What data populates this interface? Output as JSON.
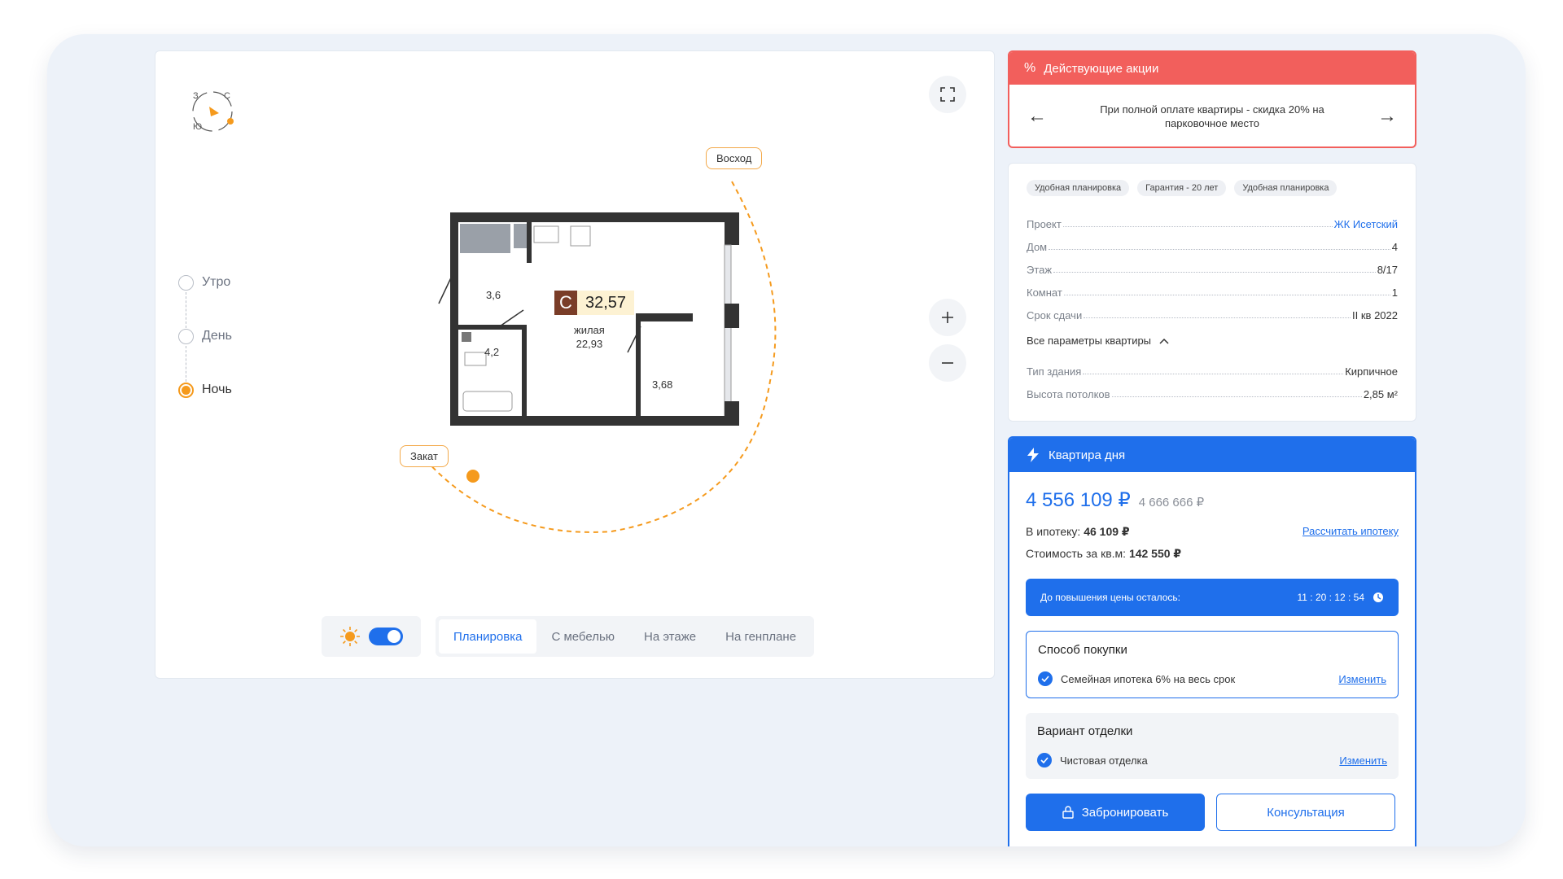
{
  "compass": {
    "w": "З",
    "n": "С",
    "s": "Ю"
  },
  "time_of_day": [
    {
      "label": "Утро",
      "selected": false
    },
    {
      "label": "День",
      "selected": false
    },
    {
      "label": "Ночь",
      "selected": true
    }
  ],
  "plan": {
    "sunrise": "Восход",
    "sunset": "Закат",
    "room_hall": "3,6",
    "room_bath": "4,2",
    "room_balcony": "3,68",
    "badge_letter": "С",
    "total_area": "32,57",
    "living_label": "жилая",
    "living_area": "22,93"
  },
  "view_tabs": [
    {
      "label": "Планировка",
      "active": true
    },
    {
      "label": "С мебелью",
      "active": false
    },
    {
      "label": "На этаже",
      "active": false
    },
    {
      "label": "На генплане",
      "active": false
    }
  ],
  "promo": {
    "title": "Действующие акции",
    "text": "При полной оплате квартиры - скидка 20% на парковочное место"
  },
  "params": {
    "chips": [
      "Удобная планировка",
      "Гарантия - 20 лет",
      "Удобная планировка"
    ],
    "rows": [
      {
        "label": "Проект",
        "value": "ЖК Исетский"
      },
      {
        "label": "Дом",
        "value": "4"
      },
      {
        "label": "Этаж",
        "value": "8/17"
      },
      {
        "label": "Комнат",
        "value": "1"
      },
      {
        "label": "Срок сдачи",
        "value": "II кв 2022"
      }
    ],
    "all_label": "Все параметры квартиры",
    "extra_rows": [
      {
        "label": "Тип здания",
        "value": "Кирпичное"
      },
      {
        "label": "Высота потолков",
        "value": "2,85 м²"
      }
    ]
  },
  "deal": {
    "title": "Квартира дня",
    "price": "4 556 109 ₽",
    "old_price": "4 666 666 ₽",
    "mortgage_label": "В ипотеку:",
    "mortgage_value": "46 109 ₽",
    "mortgage_link": "Рассчитать ипотеку",
    "sqm_label": "Стоимость за кв.м:",
    "sqm_value": "142 550 ₽",
    "timer_label": "До повышения цены осталось:",
    "timer_value": "11 : 20 : 12 : 54",
    "purchase_title": "Способ покупки",
    "purchase_value": "Семейная ипотека 6% на весь срок",
    "change_label": "Изменить",
    "finish_title": "Вариант отделки",
    "finish_value": "Чистовая отделка",
    "book_label": "Забронировать",
    "consult_label": "Консультация"
  },
  "colors": {
    "accent": "#1f6feb",
    "promo": "#f25f5c",
    "sun": "#f59a1d"
  }
}
